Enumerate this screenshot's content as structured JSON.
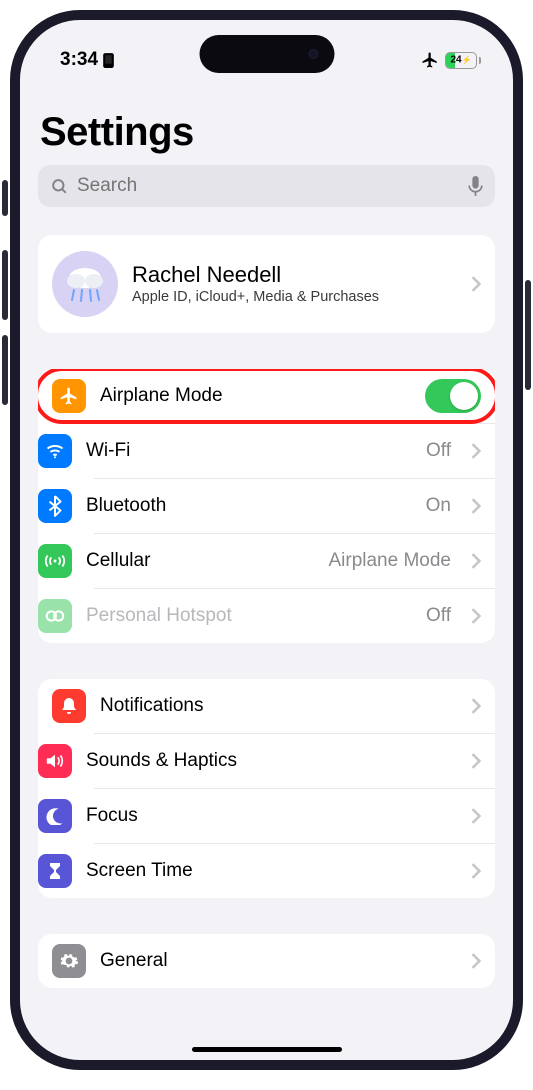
{
  "status": {
    "time": "3:34",
    "battery_pct": "24",
    "airplane_active": true
  },
  "title": "Settings",
  "search": {
    "placeholder": "Search"
  },
  "profile": {
    "name": "Rachel Needell",
    "subtitle": "Apple ID, iCloud+, Media & Purchases"
  },
  "group1": [
    {
      "icon": "airplane",
      "color": "#ff9500",
      "label": "Airplane Mode",
      "control": "toggle",
      "on": true,
      "highlight": true
    },
    {
      "icon": "wifi",
      "color": "#007aff",
      "label": "Wi-Fi",
      "value": "Off"
    },
    {
      "icon": "bluetooth",
      "color": "#007aff",
      "label": "Bluetooth",
      "value": "On"
    },
    {
      "icon": "cellular",
      "color": "#34c759",
      "label": "Cellular",
      "value": "Airplane Mode"
    },
    {
      "icon": "hotspot",
      "color": "#34c759",
      "label": "Personal Hotspot",
      "value": "Off",
      "disabled": true
    }
  ],
  "group2": [
    {
      "icon": "bell",
      "color": "#ff3b30",
      "label": "Notifications"
    },
    {
      "icon": "speaker",
      "color": "#ff2d55",
      "label": "Sounds & Haptics"
    },
    {
      "icon": "moon",
      "color": "#5856d6",
      "label": "Focus"
    },
    {
      "icon": "hourglass",
      "color": "#5856d6",
      "label": "Screen Time"
    }
  ],
  "group3": [
    {
      "icon": "gear",
      "color": "#8e8e93",
      "label": "General"
    }
  ]
}
